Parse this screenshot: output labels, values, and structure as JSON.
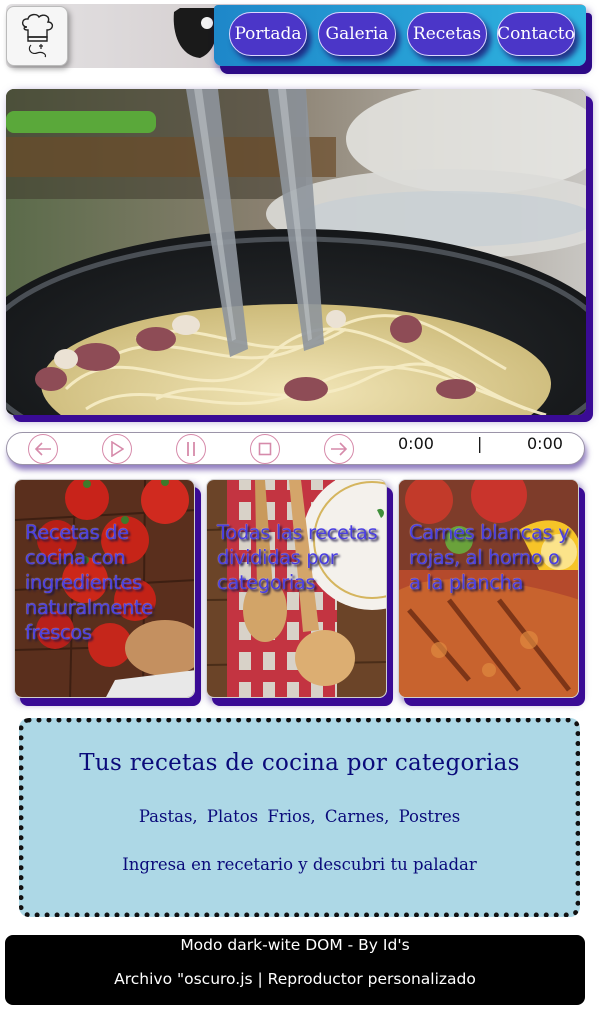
{
  "nav": {
    "items": [
      {
        "label": "Portada"
      },
      {
        "label": "Galeria"
      },
      {
        "label": "Recetas"
      },
      {
        "label": "Contacto"
      }
    ]
  },
  "logo": {
    "icon": "chef-hat-icon"
  },
  "theme_toggle": {
    "icon": "toggle-knob-icon"
  },
  "hero": {
    "description_icon": "pasta-pan-image"
  },
  "player": {
    "controls": [
      "prev-icon",
      "play-icon",
      "pause-icon",
      "stop-icon",
      "next-icon"
    ],
    "current_time": "0:00",
    "separator": "|",
    "duration": "0:00",
    "accent_color": "#d68aaa"
  },
  "cards": [
    {
      "text": "Recetas de cocina con ingredientes naturalmente frescos"
    },
    {
      "text": "Todas las recetas divididas por categorias"
    },
    {
      "text": "Carnes blancas y rojas, al horno o a la plancha"
    }
  ],
  "info": {
    "title": "Tus recetas de cocina por categorias",
    "categories": "Pastas,  Platos Frios,  Carnes,  Postres",
    "subtitle": "Ingresa en recetario y descubri tu paladar"
  },
  "footer": {
    "line1": "Modo dark-wite DOM - By Id's",
    "line2": "Archivo \"oscuro.js | Reproductor personalizado"
  },
  "colors": {
    "nav_button": "#4b36c8",
    "shadow": "#3a0b95",
    "info_bg": "#add8e6",
    "info_text": "#0a0a7a",
    "footer_bg": "#000000"
  }
}
